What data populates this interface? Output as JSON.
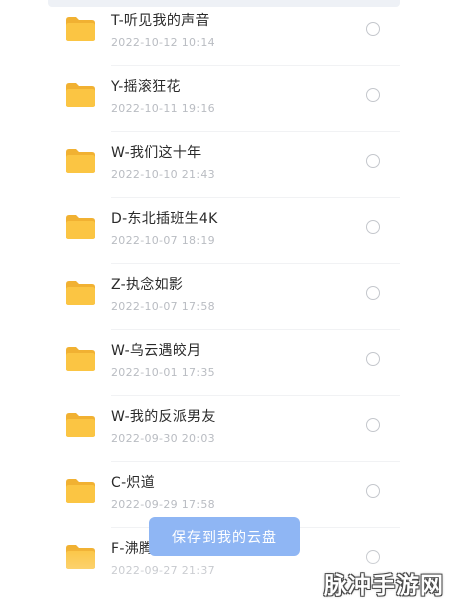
{
  "files": [
    {
      "name": "T-听见我的声音",
      "date": "2022-10-12 10:14"
    },
    {
      "name": "Y-摇滚狂花",
      "date": "2022-10-11 19:16"
    },
    {
      "name": "W-我们这十年",
      "date": "2022-10-10 21:43"
    },
    {
      "name": "D-东北插班生4K",
      "date": "2022-10-07 18:19"
    },
    {
      "name": "Z-执念如影",
      "date": "2022-10-07 17:58"
    },
    {
      "name": "W-乌云遇皎月",
      "date": "2022-10-01 17:35"
    },
    {
      "name": "W-我的反派男友",
      "date": "2022-09-30 20:03"
    },
    {
      "name": "C-炽道",
      "date": "2022-09-29 17:58"
    },
    {
      "name": "F-沸腾",
      "date": "2022-09-27 21:37"
    }
  ],
  "save_button": {
    "label": "保存到我的云盘"
  },
  "watermark": {
    "text": "脉冲手游网"
  },
  "icons": {
    "folder": "folder-icon",
    "radio": "radio-unchecked"
  },
  "colors": {
    "folder": "#fbc543",
    "folder_tab": "#f1b132",
    "save_button_bg": "#8fb6f4",
    "date_text": "#b9bcc2"
  }
}
